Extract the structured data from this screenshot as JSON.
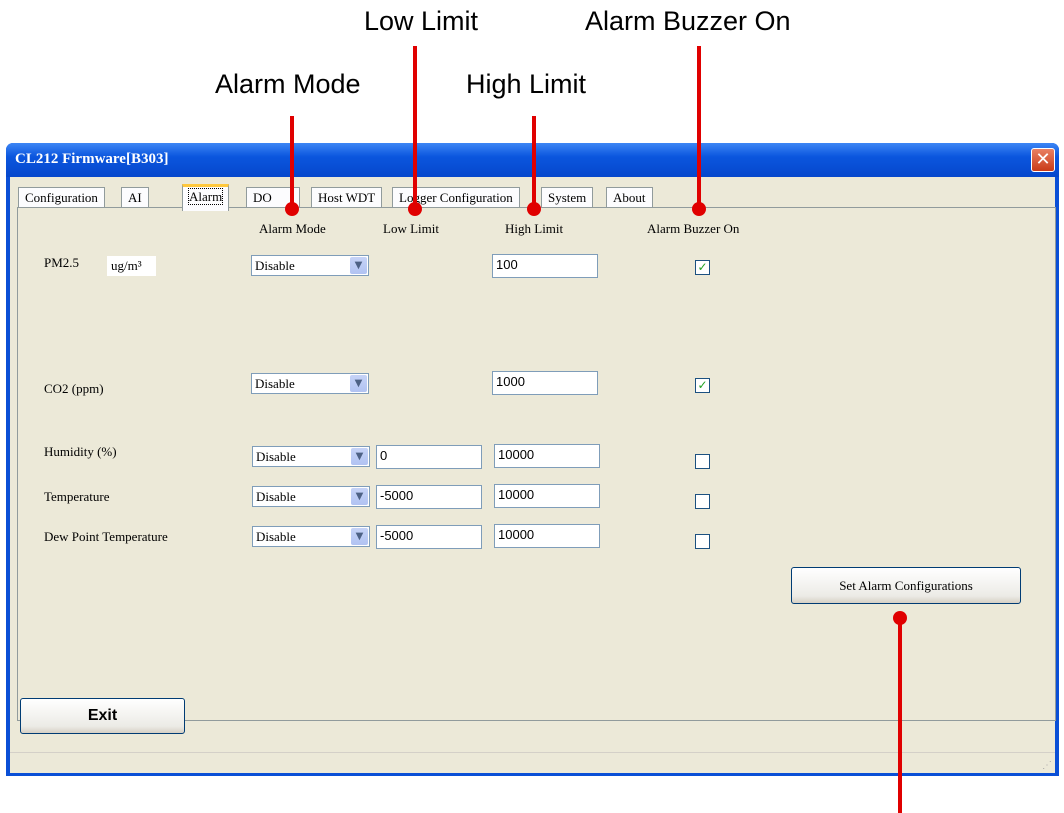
{
  "annotations": {
    "alarm_mode": "Alarm Mode",
    "low_limit": "Low Limit",
    "high_limit": "High Limit",
    "alarm_buzzer_on": "Alarm Buzzer On",
    "color": "#e00000"
  },
  "window": {
    "title": "CL212 Firmware[B303]",
    "close_icon": "close-icon"
  },
  "tabs": [
    {
      "label": "Configuration"
    },
    {
      "label": "AI"
    },
    {
      "label": "Alarm",
      "active": true
    },
    {
      "label": "DO"
    },
    {
      "label": "Host WDT"
    },
    {
      "label": "Logger Configuration"
    },
    {
      "label": "System"
    },
    {
      "label": "About"
    }
  ],
  "columns": {
    "alarm_mode": "Alarm Mode",
    "low_limit": "Low Limit",
    "high_limit": "High Limit",
    "alarm_buzzer_on": "Alarm Buzzer On"
  },
  "rows": {
    "pm25": {
      "label": "PM2.5",
      "unit": "ug/m³",
      "mode": "Disable",
      "high": "100",
      "buzzer": true
    },
    "co2": {
      "label": "CO2 (ppm)",
      "mode": "Disable",
      "high": "1000",
      "buzzer": true
    },
    "humidity": {
      "label": "Humidity (%)",
      "mode": "Disable",
      "low": "0",
      "high": "10000",
      "buzzer": false
    },
    "temperature": {
      "label": "Temperature",
      "mode": "Disable",
      "low": "-5000",
      "high": "10000",
      "buzzer": false
    },
    "dew_point": {
      "label": "Dew Point Temperature",
      "mode": "Disable",
      "low": "-5000",
      "high": "10000",
      "buzzer": false
    }
  },
  "buttons": {
    "set_alarm": "Set Alarm Configurations",
    "exit": "Exit"
  },
  "checkmark": "✓"
}
